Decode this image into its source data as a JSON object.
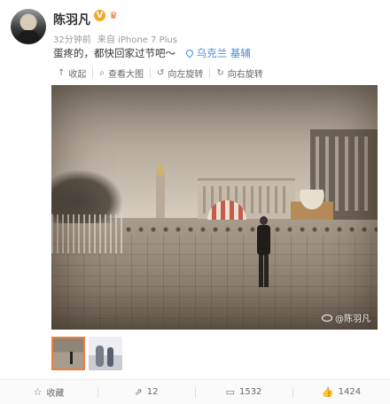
{
  "post": {
    "username": "陈羽凡",
    "verified_badge": "V",
    "time": "32分钟前",
    "source": "来自 iPhone 7 Plus",
    "text": "蛋疼的，都快回家过节吧～",
    "location": "乌克兰 基辅",
    "watermark": "@陈羽凡"
  },
  "toolbar": [
    {
      "icon": "collapse-icon",
      "glyph": "↑",
      "label": "收起"
    },
    {
      "icon": "zoom-icon",
      "glyph": "⌕",
      "label": "查看大图"
    },
    {
      "icon": "rotate-left-icon",
      "glyph": "↺",
      "label": "向左旋转"
    },
    {
      "icon": "rotate-right-icon",
      "glyph": "↻",
      "label": "向右旋转"
    }
  ],
  "actions": [
    {
      "icon": "star-icon",
      "glyph": "☆",
      "label": "收藏"
    },
    {
      "icon": "forward-icon",
      "glyph": "⇗",
      "label": "12"
    },
    {
      "icon": "comment-icon",
      "glyph": "▭",
      "label": "1532"
    },
    {
      "icon": "like-icon",
      "glyph": "👍",
      "label": "1424"
    }
  ],
  "colors": {
    "accent": "#eb7350",
    "location": "#4a8bd8",
    "selected_thumb_border": "#f07d3a"
  }
}
